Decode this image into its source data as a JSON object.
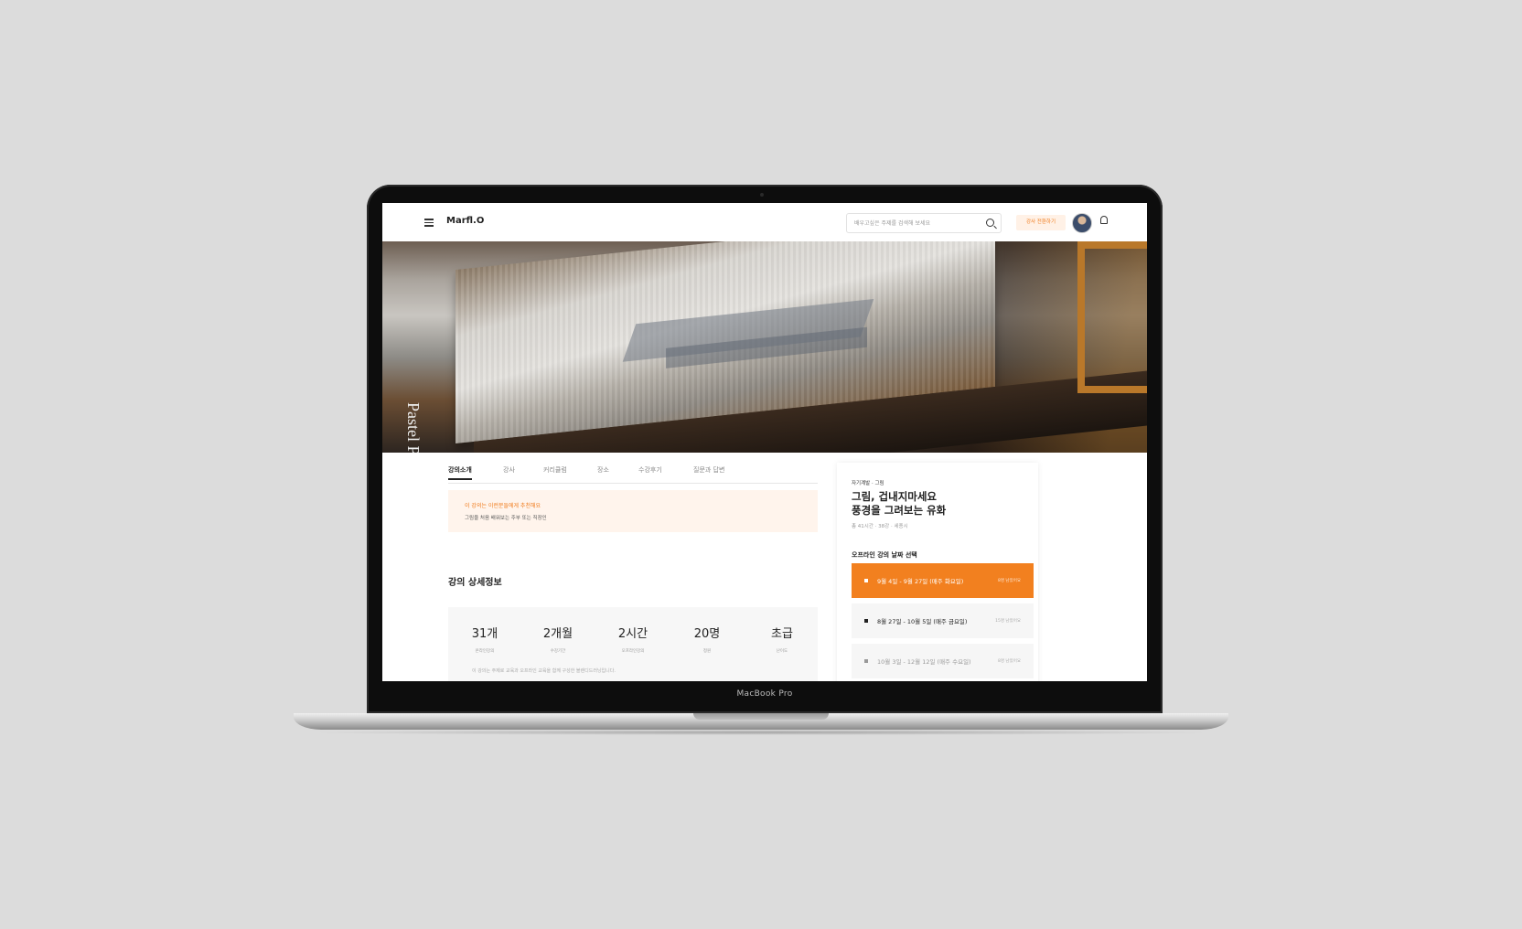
{
  "device": {
    "label": "MacBook Pro"
  },
  "header": {
    "logo": "Marfl.O",
    "search_placeholder": "배우고싶은 주제를 검색해 보세요",
    "instructor_button": "강사 전환하기"
  },
  "hero": {
    "text": "Pastel P"
  },
  "tabs": [
    {
      "label": "강의소개",
      "active": true
    },
    {
      "label": "강사"
    },
    {
      "label": "커리큘럼"
    },
    {
      "label": "장소"
    },
    {
      "label": "수강후기"
    },
    {
      "label": "질문과 답변"
    }
  ],
  "recommend": {
    "title": "이 강의는 이런분들에게 추천해요",
    "subtitle": "그림을 처음 배워보는 주부 또는 직장인"
  },
  "detail": {
    "title": "강의 상세정보",
    "stats": [
      {
        "value": "31개",
        "label": "온라인강의"
      },
      {
        "value": "2개월",
        "label": "수강기간"
      },
      {
        "value": "2시간",
        "label": "오프라인강의"
      },
      {
        "value": "20명",
        "label": "정원"
      },
      {
        "value": "초급",
        "label": "난이도"
      }
    ],
    "note": "이 강의는 주제로 교육과 오프라인 교육을 함께 구성한 블렌디드러닝입니다."
  },
  "sidebar": {
    "category": "자기계발 · 그림",
    "title_line1": "그림, 겁내지마세요",
    "title_line2": "풍경을 그려보는 유화",
    "meta": "총 41시간 · 38강 · 세종시",
    "section": "오프라인 강의 날짜 선택",
    "options": [
      {
        "text": "9월 4일 - 9월 27일 (매주 화요일)",
        "status": "8명 남았어요",
        "selected": true
      },
      {
        "text": "8월 27일 - 10월 5일 (매주 금요일)",
        "status": "15명 남았어요"
      },
      {
        "text": "10월 3일 - 12월 12일 (매주 수요일)",
        "status": "8명 남았어요"
      }
    ]
  },
  "colors": {
    "accent": "#f2801f",
    "accent_light": "#fff4ec"
  }
}
